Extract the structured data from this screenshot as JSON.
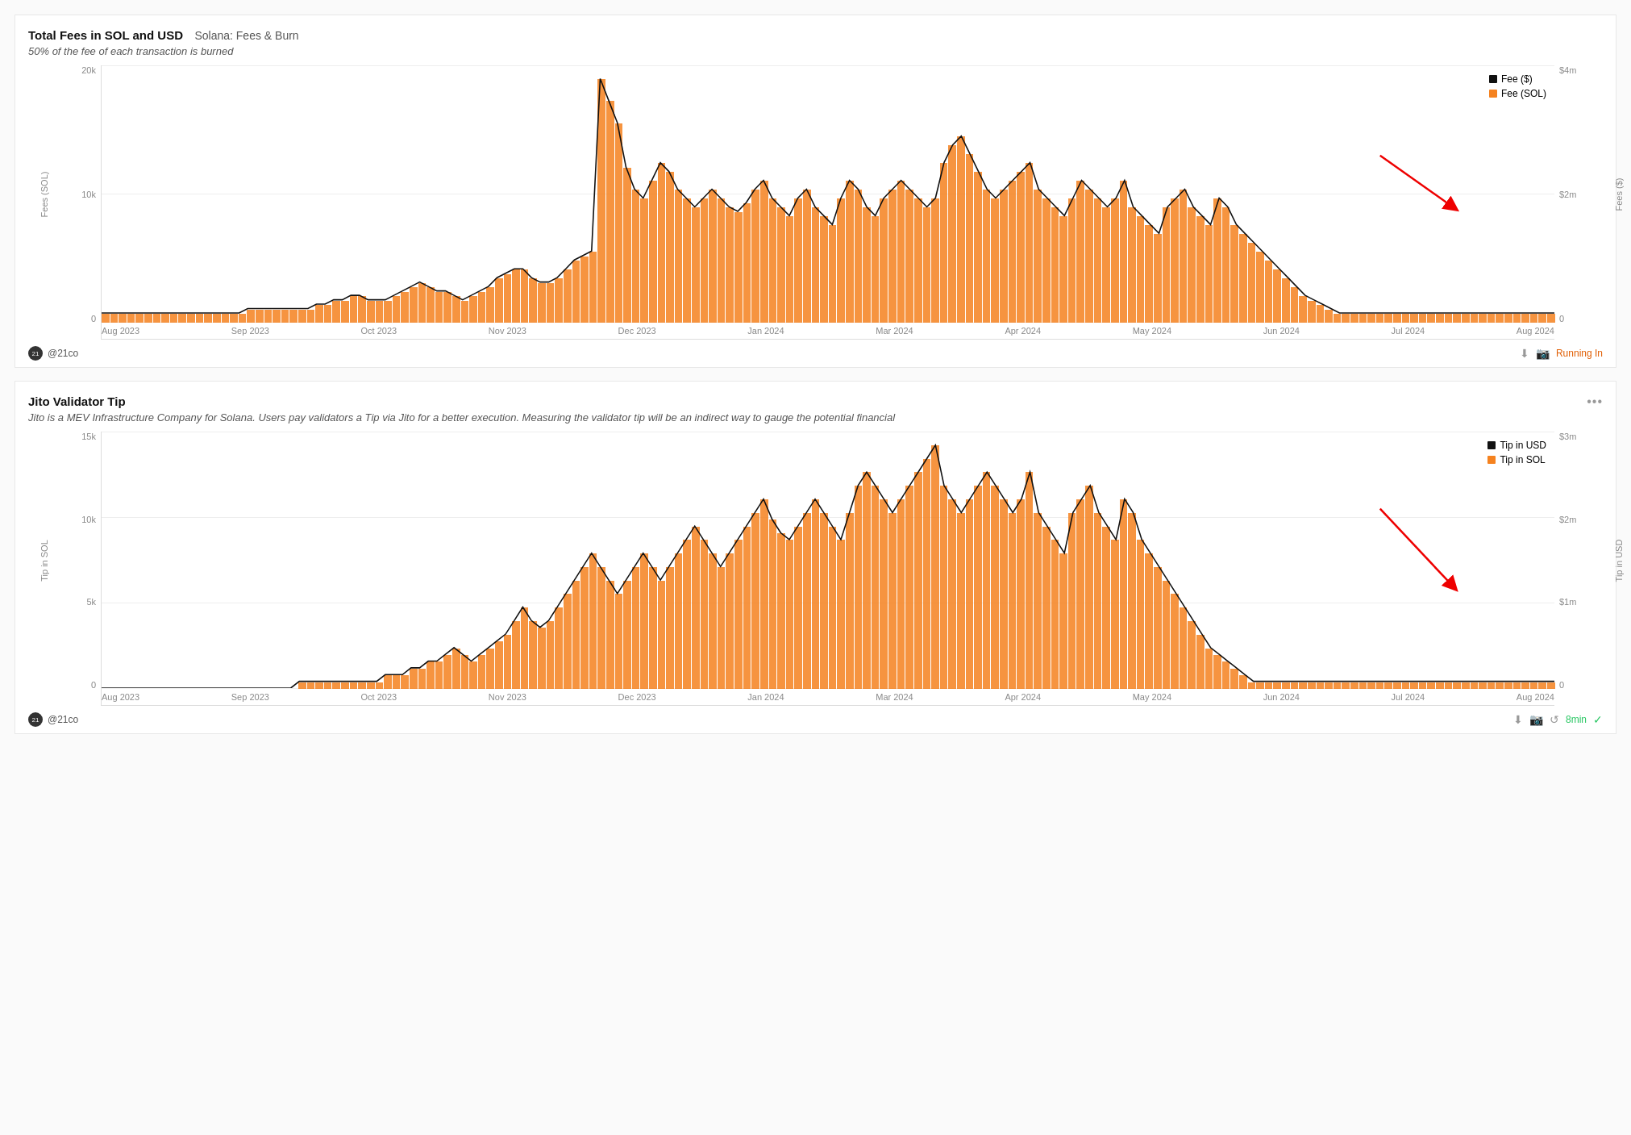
{
  "chart1": {
    "title": "Total Fees in SOL and USD",
    "source": "Solana: Fees & Burn",
    "description": "50% of the fee of each transaction is burned",
    "y_axis_left_label": "Fees (SOL)",
    "y_axis_right_label": "Fees ($)",
    "y_left_ticks": [
      "20k",
      "10k",
      "0"
    ],
    "y_right_ticks": [
      "$4m",
      "$2m",
      "0"
    ],
    "x_ticks": [
      "Aug 2023",
      "Sep 2023",
      "Oct 2023",
      "Nov 2023",
      "Dec 2023",
      "Jan 2024",
      "Mar 2024",
      "Apr 2024",
      "May 2024",
      "Jun 2024",
      "Jul 2024",
      "Aug 2024"
    ],
    "legend": [
      {
        "label": "Fee ($)",
        "color": "#111"
      },
      {
        "label": "Fee (SOL)",
        "color": "#f5821f"
      }
    ],
    "footer_author": "@21co",
    "footer_status": "Running In",
    "bars": [
      2,
      2,
      2,
      2,
      2,
      2,
      2,
      2,
      2,
      2,
      2,
      2,
      2,
      2,
      2,
      2,
      2,
      3,
      3,
      3,
      3,
      3,
      3,
      3,
      3,
      4,
      4,
      5,
      5,
      6,
      6,
      5,
      5,
      5,
      6,
      7,
      8,
      9,
      8,
      7,
      7,
      6,
      5,
      6,
      7,
      8,
      10,
      11,
      12,
      12,
      10,
      9,
      9,
      10,
      12,
      14,
      15,
      16,
      55,
      50,
      45,
      35,
      30,
      28,
      32,
      36,
      34,
      30,
      28,
      26,
      28,
      30,
      28,
      26,
      25,
      27,
      30,
      32,
      28,
      26,
      24,
      28,
      30,
      26,
      24,
      22,
      28,
      32,
      30,
      26,
      24,
      28,
      30,
      32,
      30,
      28,
      26,
      28,
      36,
      40,
      42,
      38,
      34,
      30,
      28,
      30,
      32,
      34,
      36,
      30,
      28,
      26,
      24,
      28,
      32,
      30,
      28,
      26,
      28,
      32,
      26,
      24,
      22,
      20,
      26,
      28,
      30,
      26,
      24,
      22,
      28,
      26,
      22,
      20,
      18,
      16,
      14,
      12,
      10,
      8,
      6,
      5,
      4,
      3,
      2,
      2,
      2,
      2,
      2,
      2,
      2,
      2,
      2,
      2,
      2,
      2,
      2,
      2,
      2,
      2,
      2,
      2,
      2,
      2,
      2,
      2,
      2,
      2,
      2,
      2
    ]
  },
  "chart2": {
    "title": "Jito Validator Tip",
    "description": "Jito is a MEV Infrastructure Company for Solana. Users pay validators a Tip via Jito for a better execution. Measuring the validator tip will be an indirect way to gauge the potential financial",
    "y_axis_left_label": "Tip in SOL",
    "y_axis_right_label": "Tip in USD",
    "y_left_ticks": [
      "15k",
      "10k",
      "5k",
      "0"
    ],
    "y_right_ticks": [
      "$3m",
      "$2m",
      "$1m",
      "0"
    ],
    "x_ticks": [
      "Aug 2023",
      "Sep 2023",
      "Oct 2023",
      "Nov 2023",
      "Dec 2023",
      "Jan 2024",
      "Mar 2024",
      "Apr 2024",
      "May 2024",
      "Jun 2024",
      "Jul 2024",
      "Aug 2024"
    ],
    "legend": [
      {
        "label": "Tip in USD",
        "color": "#111"
      },
      {
        "label": "Tip in SOL",
        "color": "#f5821f"
      }
    ],
    "footer_author": "@21co",
    "footer_time": "8min",
    "bars": [
      0,
      0,
      0,
      0,
      0,
      0,
      0,
      0,
      0,
      0,
      0,
      0,
      0,
      0,
      0,
      0,
      0,
      0,
      0,
      0,
      0,
      0,
      0,
      1,
      1,
      1,
      1,
      1,
      1,
      1,
      1,
      1,
      1,
      2,
      2,
      2,
      3,
      3,
      4,
      4,
      5,
      6,
      5,
      4,
      5,
      6,
      7,
      8,
      10,
      12,
      10,
      9,
      10,
      12,
      14,
      16,
      18,
      20,
      18,
      16,
      14,
      16,
      18,
      20,
      18,
      16,
      18,
      20,
      22,
      24,
      22,
      20,
      18,
      20,
      22,
      24,
      26,
      28,
      25,
      23,
      22,
      24,
      26,
      28,
      26,
      24,
      22,
      26,
      30,
      32,
      30,
      28,
      26,
      28,
      30,
      32,
      34,
      36,
      30,
      28,
      26,
      28,
      30,
      32,
      30,
      28,
      26,
      28,
      32,
      26,
      24,
      22,
      20,
      26,
      28,
      30,
      26,
      24,
      22,
      28,
      26,
      22,
      20,
      18,
      16,
      14,
      12,
      10,
      8,
      6,
      5,
      4,
      3,
      2,
      1,
      1,
      1,
      1,
      1,
      1,
      1,
      1,
      1,
      1,
      1,
      1,
      1,
      1,
      1,
      1,
      1,
      1,
      1,
      1,
      1,
      1,
      1,
      1,
      1,
      1,
      1,
      1,
      1,
      1,
      1,
      1,
      1,
      1,
      1,
      1
    ]
  }
}
